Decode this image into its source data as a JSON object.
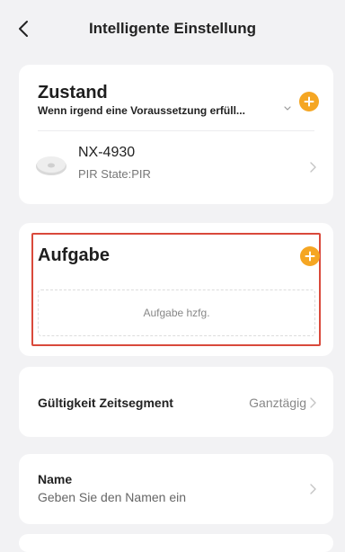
{
  "header": {
    "title": "Intelligente Einstellung"
  },
  "condition": {
    "title": "Zustand",
    "subtitle": "Wenn irgend eine Voraussetzung erfüll...",
    "device": {
      "name": "NX-4930",
      "state": "PIR State:PIR"
    }
  },
  "task": {
    "title": "Aufgabe",
    "placeholder": "Aufgabe hzfg."
  },
  "validity": {
    "label": "Gültigkeit Zeitsegment",
    "value": "Ganztägig"
  },
  "name": {
    "label": "Name",
    "placeholder": "Geben Sie den Namen ein"
  },
  "colors": {
    "accent": "#f5a623",
    "highlight": "#d9493b",
    "background": "#f2f2f4"
  },
  "icons": {
    "back": "chevron-left-icon",
    "add": "plus-circle-icon",
    "dropdown": "chevron-down-icon",
    "row": "chevron-right-icon",
    "device": "motion-sensor-icon"
  }
}
